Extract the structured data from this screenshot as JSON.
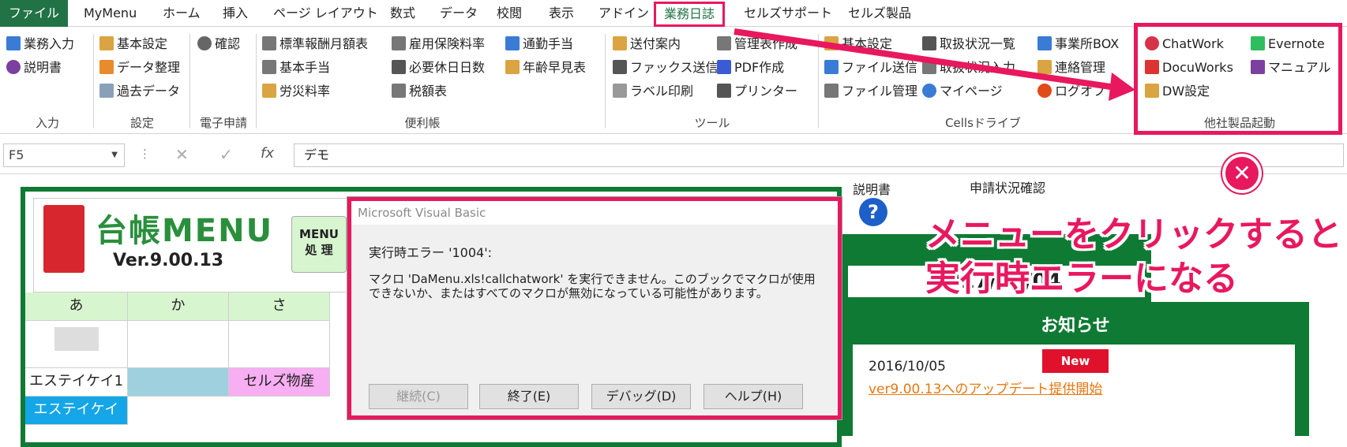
{
  "menubar": {
    "file": "ファイル",
    "items": [
      "MyMenu",
      "ホーム",
      "挿入",
      "ページ レイアウト",
      "数式",
      "データ",
      "校閲",
      "表示",
      "アドイン",
      "業務日誌",
      "セルズサポート",
      "セルズ製品"
    ]
  },
  "ribbon": {
    "input": {
      "items": [
        "業務入力",
        "説明書"
      ],
      "label": "入力"
    },
    "settings": {
      "items": [
        "基本設定",
        "データ整理",
        "過去データ"
      ],
      "label": "設定"
    },
    "e_apply": {
      "items": [
        "確認"
      ],
      "label": "電子申請"
    },
    "convenience": {
      "items": [
        "標準報酬月額表",
        "雇用保険料率",
        "通勤手当",
        "基本手当",
        "必要休日日数",
        "年齢早見表",
        "労災料率",
        "税額表"
      ],
      "label": "便利帳"
    },
    "tools": {
      "items": [
        "送付案内",
        "管理表作成",
        "ファックス送信",
        "PDF作成",
        "ラベル印刷",
        "プリンター"
      ],
      "label": "ツール"
    },
    "cells_drive": {
      "items": [
        "基本設定",
        "取扱状況一覧",
        "事業所BOX",
        "ファイル送信",
        "取扱状況入力",
        "連絡管理",
        "ファイル管理",
        "マイページ",
        "ログオフ"
      ],
      "label": "Cellsドライブ"
    },
    "other_products": {
      "items": [
        "ChatWork",
        "Evernote",
        "DocuWorks",
        "マニュアル",
        "DW設定"
      ],
      "label": "他社製品起動"
    }
  },
  "formula": {
    "cell": "F5",
    "value": "デモ",
    "fx": "fx"
  },
  "sheet": {
    "title": "台帳MENU",
    "version": "Ver.9.00.13",
    "menu_btn": "MENU\n処 理",
    "headers": [
      "あ",
      "か",
      "さ"
    ],
    "row1": [
      "エステイケイ1",
      "",
      "セルズ物産"
    ],
    "row2": [
      "エステイケイ"
    ],
    "manual": "説明書",
    "status_check": "申請状況確認",
    "date": "2017/10/04",
    "news_title": "お知らせ",
    "news_date": "2016/10/05",
    "news_badge": "New",
    "news_link": "ver9.00.13へのアップデート提供開始"
  },
  "dialog": {
    "title": "Microsoft Visual Basic",
    "error": "実行時エラー '1004':",
    "message": "マクロ 'DaMenu.xls!callchatwork' を実行できません。このブックでマクロが使用できないか、またはすべてのマクロが無効になっている可能性があります。",
    "buttons": [
      "継続(C)",
      "終了(E)",
      "デバッグ(D)",
      "ヘルプ(H)"
    ]
  },
  "callout": {
    "line1": "メニューをクリックすると",
    "line2": "実行時エラーになる"
  },
  "colors": {
    "excel_green": "#217346",
    "highlight": "#e8185f"
  }
}
